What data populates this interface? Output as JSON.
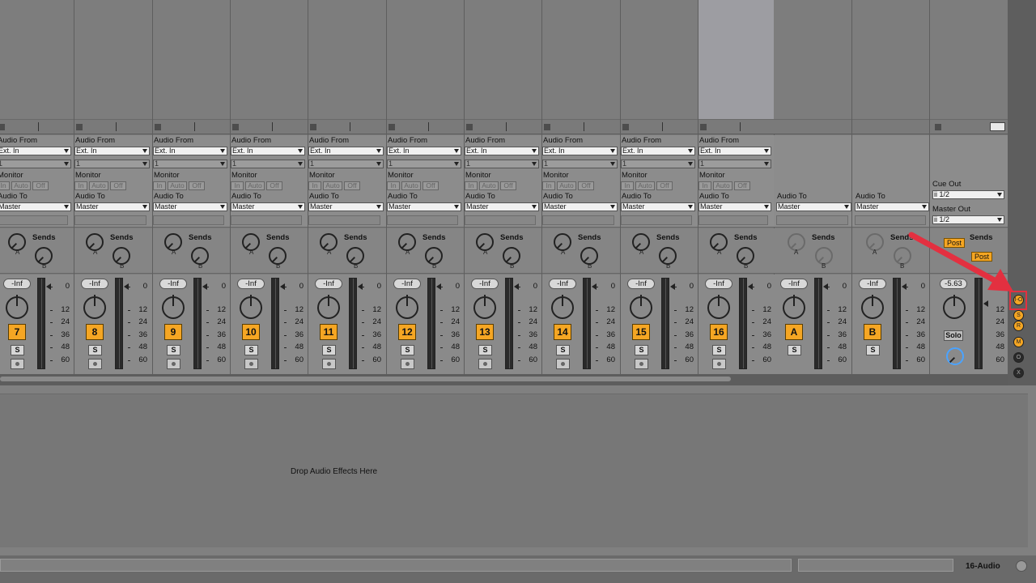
{
  "channels": [
    {
      "num": "7",
      "vol": "-Inf",
      "selected": false
    },
    {
      "num": "8",
      "vol": "-Inf",
      "selected": false
    },
    {
      "num": "9",
      "vol": "-Inf",
      "selected": false
    },
    {
      "num": "10",
      "vol": "-Inf",
      "selected": false
    },
    {
      "num": "11",
      "vol": "-Inf",
      "selected": false
    },
    {
      "num": "12",
      "vol": "-Inf",
      "selected": false
    },
    {
      "num": "13",
      "vol": "-Inf",
      "selected": false
    },
    {
      "num": "14",
      "vol": "-Inf",
      "selected": false
    },
    {
      "num": "15",
      "vol": "-Inf",
      "selected": false
    },
    {
      "num": "16",
      "vol": "-Inf",
      "selected": true
    }
  ],
  "returns": [
    {
      "num": "A",
      "vol": "-Inf"
    },
    {
      "num": "B",
      "vol": "-Inf"
    }
  ],
  "labels": {
    "audio_from": "Audio From",
    "ext_in": "Ext. In",
    "input_channel": "1",
    "monitor": "Monitor",
    "mon_in": "In",
    "mon_auto": "Auto",
    "mon_off": "Off",
    "audio_to": "Audio To",
    "master_route": "Master",
    "sends": "Sends",
    "send_a": "A",
    "send_b": "B",
    "solo_short": "S"
  },
  "meter_scale": [
    "0",
    "12",
    "24",
    "36",
    "48",
    "60"
  ],
  "master": {
    "cue_out_label": "Cue Out",
    "cue_out_value": "ii 1/2",
    "master_out_label": "Master Out",
    "master_out_value": "ii 1/2",
    "sends_label": "Sends",
    "post_a": "Post",
    "post_b": "Post",
    "vol": "-5.63",
    "solo_label": "Solo"
  },
  "device_area": {
    "drop_text": "Drop Audio Effects Here"
  },
  "status": {
    "track_name": "16-Audio"
  },
  "right_bar": {
    "io_icon": "I-O",
    "sends_icon": "S",
    "returns_icon": "R",
    "mixer_icon": "M",
    "crossfade_icon": "O",
    "delay_icon": "X"
  },
  "colors": {
    "accent": "#f5a623",
    "highlight": "#e33040"
  }
}
